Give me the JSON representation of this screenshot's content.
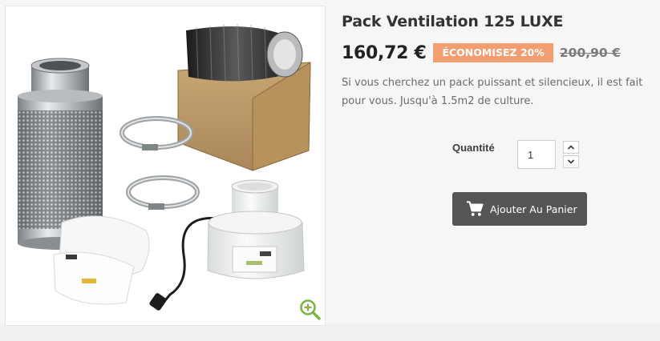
{
  "product": {
    "title": "Pack Ventilation 125 LUXE",
    "price": "160,72 €",
    "discount_badge": "ÉCONOMISEZ 20%",
    "old_price": "200,90 €",
    "description": "Si vous cherchez un pack puissant et silencieux, il est fait pour vous. Jusqu'à 1.5m2 de culture."
  },
  "purchase": {
    "quantity_label": "Quantité",
    "quantity_value": "1",
    "add_to_cart_label": "Ajouter Au Panier"
  },
  "icons": {
    "zoom": "zoom-in-icon",
    "cart": "cart-icon",
    "up": "chevron-up-icon",
    "down": "chevron-down-icon"
  },
  "colors": {
    "discount_badge_bg": "#f39d72",
    "button_bg": "#555555",
    "zoom_icon": "#7cb342"
  }
}
